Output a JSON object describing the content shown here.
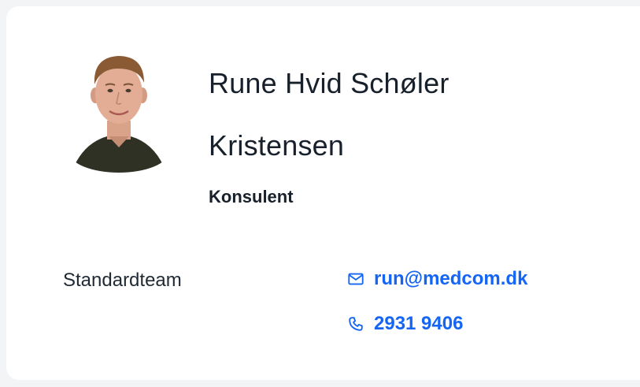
{
  "profile": {
    "name_line1": "Rune Hvid Schøler",
    "name_line2": "Kristensen",
    "title": "Konsulent",
    "team": "Standardteam",
    "email": "run@medcom.dk",
    "phone": "2931 9406"
  },
  "icons": {
    "email": "mail-icon",
    "phone": "phone-icon"
  },
  "colors": {
    "accent": "#1565f5",
    "text": "#17202b",
    "background": "#f3f4f6",
    "card": "#ffffff"
  }
}
